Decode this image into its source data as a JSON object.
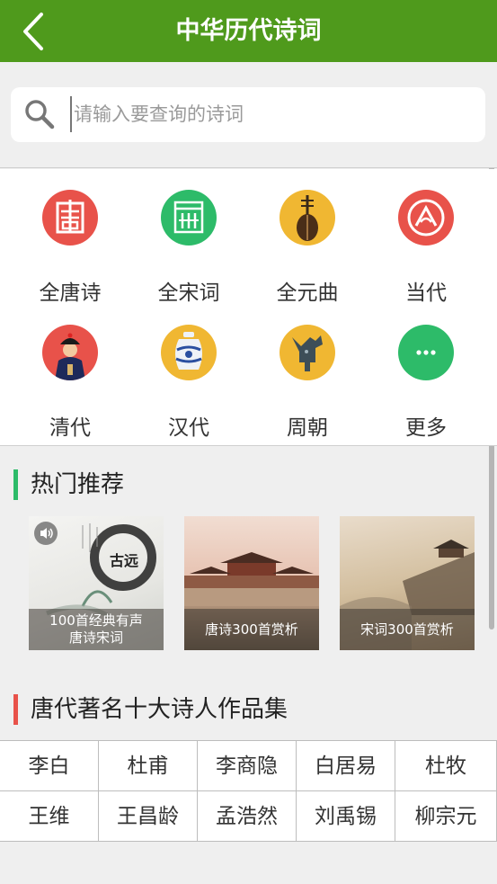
{
  "header": {
    "title": "中华历代诗词"
  },
  "search": {
    "placeholder": "请输入要查询的诗词"
  },
  "categories": [
    {
      "label": "全唐诗",
      "icon": "tang-seal-icon",
      "color": "#e8524a"
    },
    {
      "label": "全宋词",
      "icon": "song-seal-icon",
      "color": "#2dbb69"
    },
    {
      "label": "全元曲",
      "icon": "pipa-instrument-icon",
      "color": "#f0b732"
    },
    {
      "label": "当代",
      "icon": "modern-seal-icon",
      "color": "#e8524a"
    },
    {
      "label": "清代",
      "icon": "qing-official-icon",
      "color": "#e8524a"
    },
    {
      "label": "汉代",
      "icon": "porcelain-vase-icon",
      "color": "#f0b732"
    },
    {
      "label": "周朝",
      "icon": "bronze-vessel-icon",
      "color": "#f0b732"
    },
    {
      "label": "更多",
      "icon": "more-dots-icon",
      "color": "#2dbb69"
    }
  ],
  "hot": {
    "title": "热门推荐",
    "accent": "#2dbb69",
    "cards": [
      {
        "caption_line1": "100首经典有声",
        "caption_line2": "唐诗宋词",
        "art_text": "古远"
      },
      {
        "caption_line1": "唐诗300首赏析",
        "caption_line2": ""
      },
      {
        "caption_line1": "宋词300首赏析",
        "caption_line2": ""
      }
    ]
  },
  "poets": {
    "title": "唐代著名十大诗人作品集",
    "accent": "#e8524a",
    "names": [
      "李白",
      "杜甫",
      "李商隐",
      "白居易",
      "杜牧",
      "王维",
      "王昌龄",
      "孟浩然",
      "刘禹锡",
      "柳宗元"
    ]
  }
}
